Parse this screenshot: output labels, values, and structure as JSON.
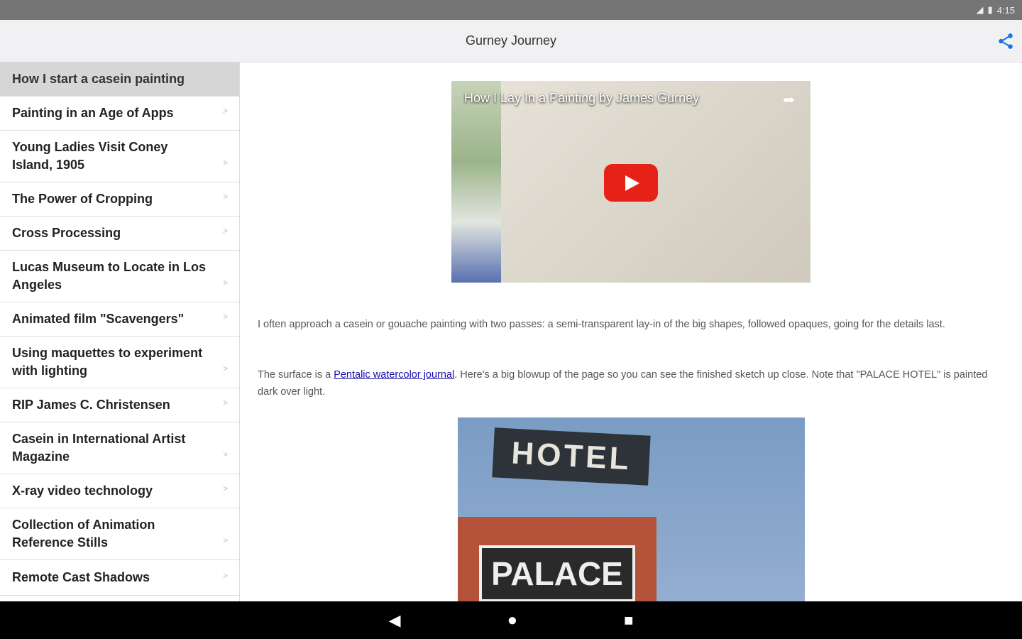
{
  "status": {
    "time": "4:15"
  },
  "header": {
    "title": "Gurney Journey"
  },
  "sidebar": {
    "items": [
      {
        "label": "How I start a casein painting"
      },
      {
        "label": "Painting in an Age of Apps"
      },
      {
        "label": "Young Ladies Visit Coney Island, 1905"
      },
      {
        "label": "The Power of Cropping"
      },
      {
        "label": "Cross Processing"
      },
      {
        "label": "Lucas Museum to Locate in Los Angeles"
      },
      {
        "label": "Animated film \"Scavengers\""
      },
      {
        "label": "Using maquettes to experiment with lighting"
      },
      {
        "label": "RIP James C. Christensen"
      },
      {
        "label": "Casein in International Artist Magazine"
      },
      {
        "label": "X-ray video technology"
      },
      {
        "label": "Collection of Animation Reference Stills"
      },
      {
        "label": "Remote Cast Shadows"
      }
    ],
    "chevron": ">"
  },
  "article": {
    "video_title": "How I Lay In a Painting by James Gurney",
    "p1": "I often approach a casein or gouache painting with two passes: a semi-transparent lay-in of the big shapes, followed opaques, going for the details last.",
    "p2_before": "The surface is a ",
    "p2_link": "Pentalic watercolor journal",
    "p2_after": ". Here's a big blowup of the page so you can see the finished sketch up close. Note that \"PALACE HOTEL\" is painted dark over light.",
    "image_text_top": "HOTEL",
    "image_text_bottom": "PALACE"
  }
}
